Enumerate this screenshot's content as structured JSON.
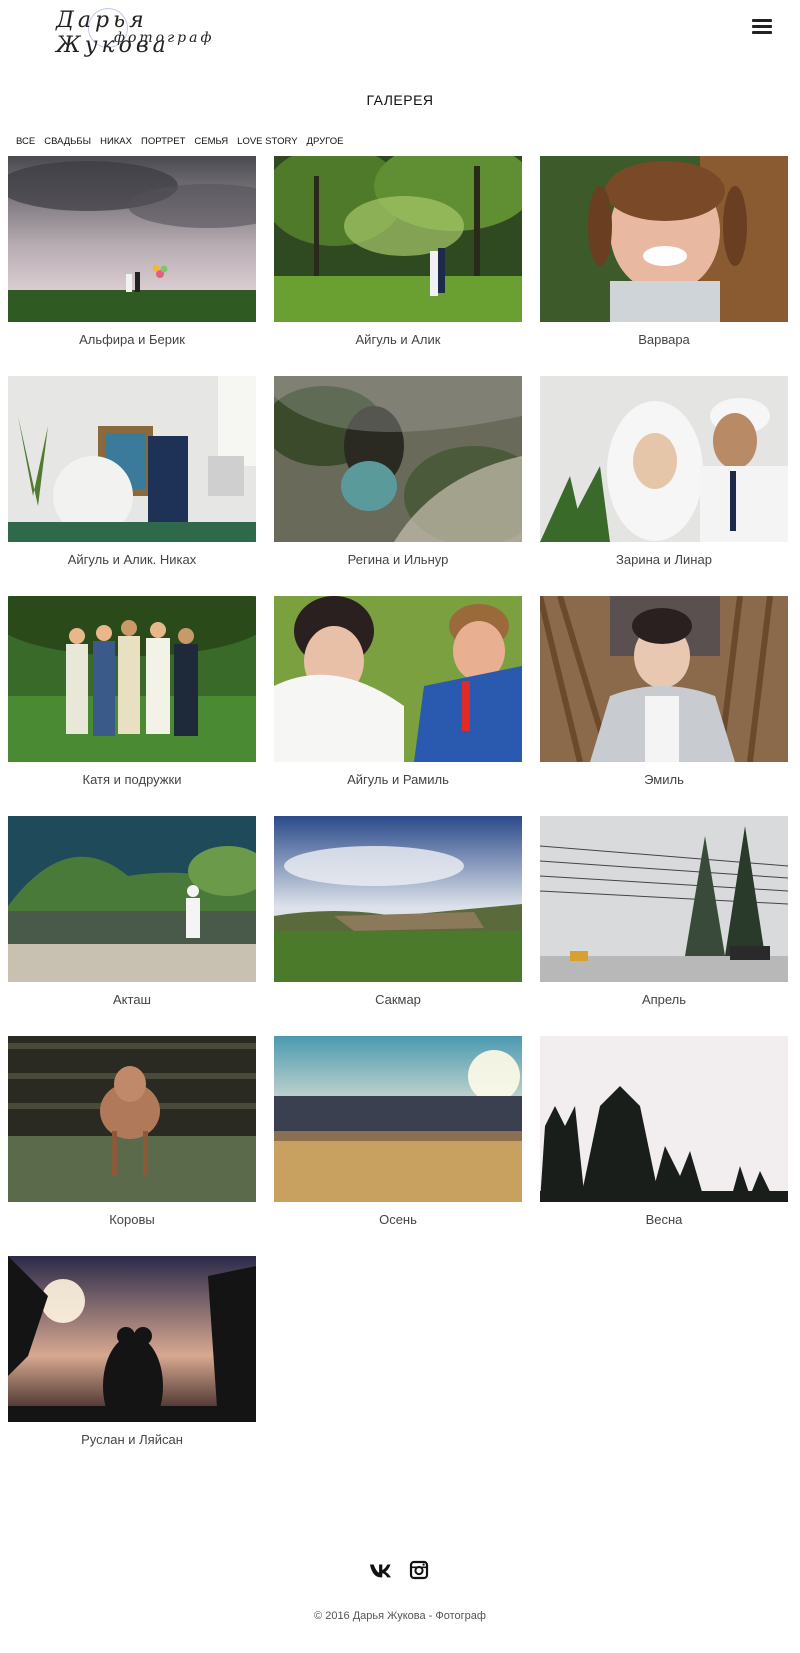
{
  "header": {
    "logo_line1": "Дарья Жукова",
    "logo_line2": "фотограф",
    "menu_icon": "hamburger-menu-icon"
  },
  "page": {
    "title": "ГАЛЕРЕЯ"
  },
  "filters": [
    "ВСЕ",
    "СВАДЬБЫ",
    "НИКАХ",
    "ПОРТРЕТ",
    "СЕМЬЯ",
    "LOVE STORY",
    "ДРУГОЕ"
  ],
  "gallery": [
    {
      "caption": "Альфира и Берик"
    },
    {
      "caption": "Айгуль и Алик"
    },
    {
      "caption": "Варвара"
    },
    {
      "caption": "Айгуль и Алик. Никах"
    },
    {
      "caption": "Регина и Ильнур"
    },
    {
      "caption": "Зарина и Линар"
    },
    {
      "caption": "Катя и подружки"
    },
    {
      "caption": "Айгуль и Рамиль"
    },
    {
      "caption": "Эмиль"
    },
    {
      "caption": "Акташ"
    },
    {
      "caption": "Сакмар"
    },
    {
      "caption": "Апрель"
    },
    {
      "caption": "Коровы"
    },
    {
      "caption": "Осень"
    },
    {
      "caption": "Весна"
    },
    {
      "caption": "Руслан и Ляйсан"
    }
  ],
  "footer": {
    "social": [
      "vk-icon",
      "instagram-icon"
    ],
    "copyright": "© 2016 Дарья Жукова - Фотограф"
  }
}
